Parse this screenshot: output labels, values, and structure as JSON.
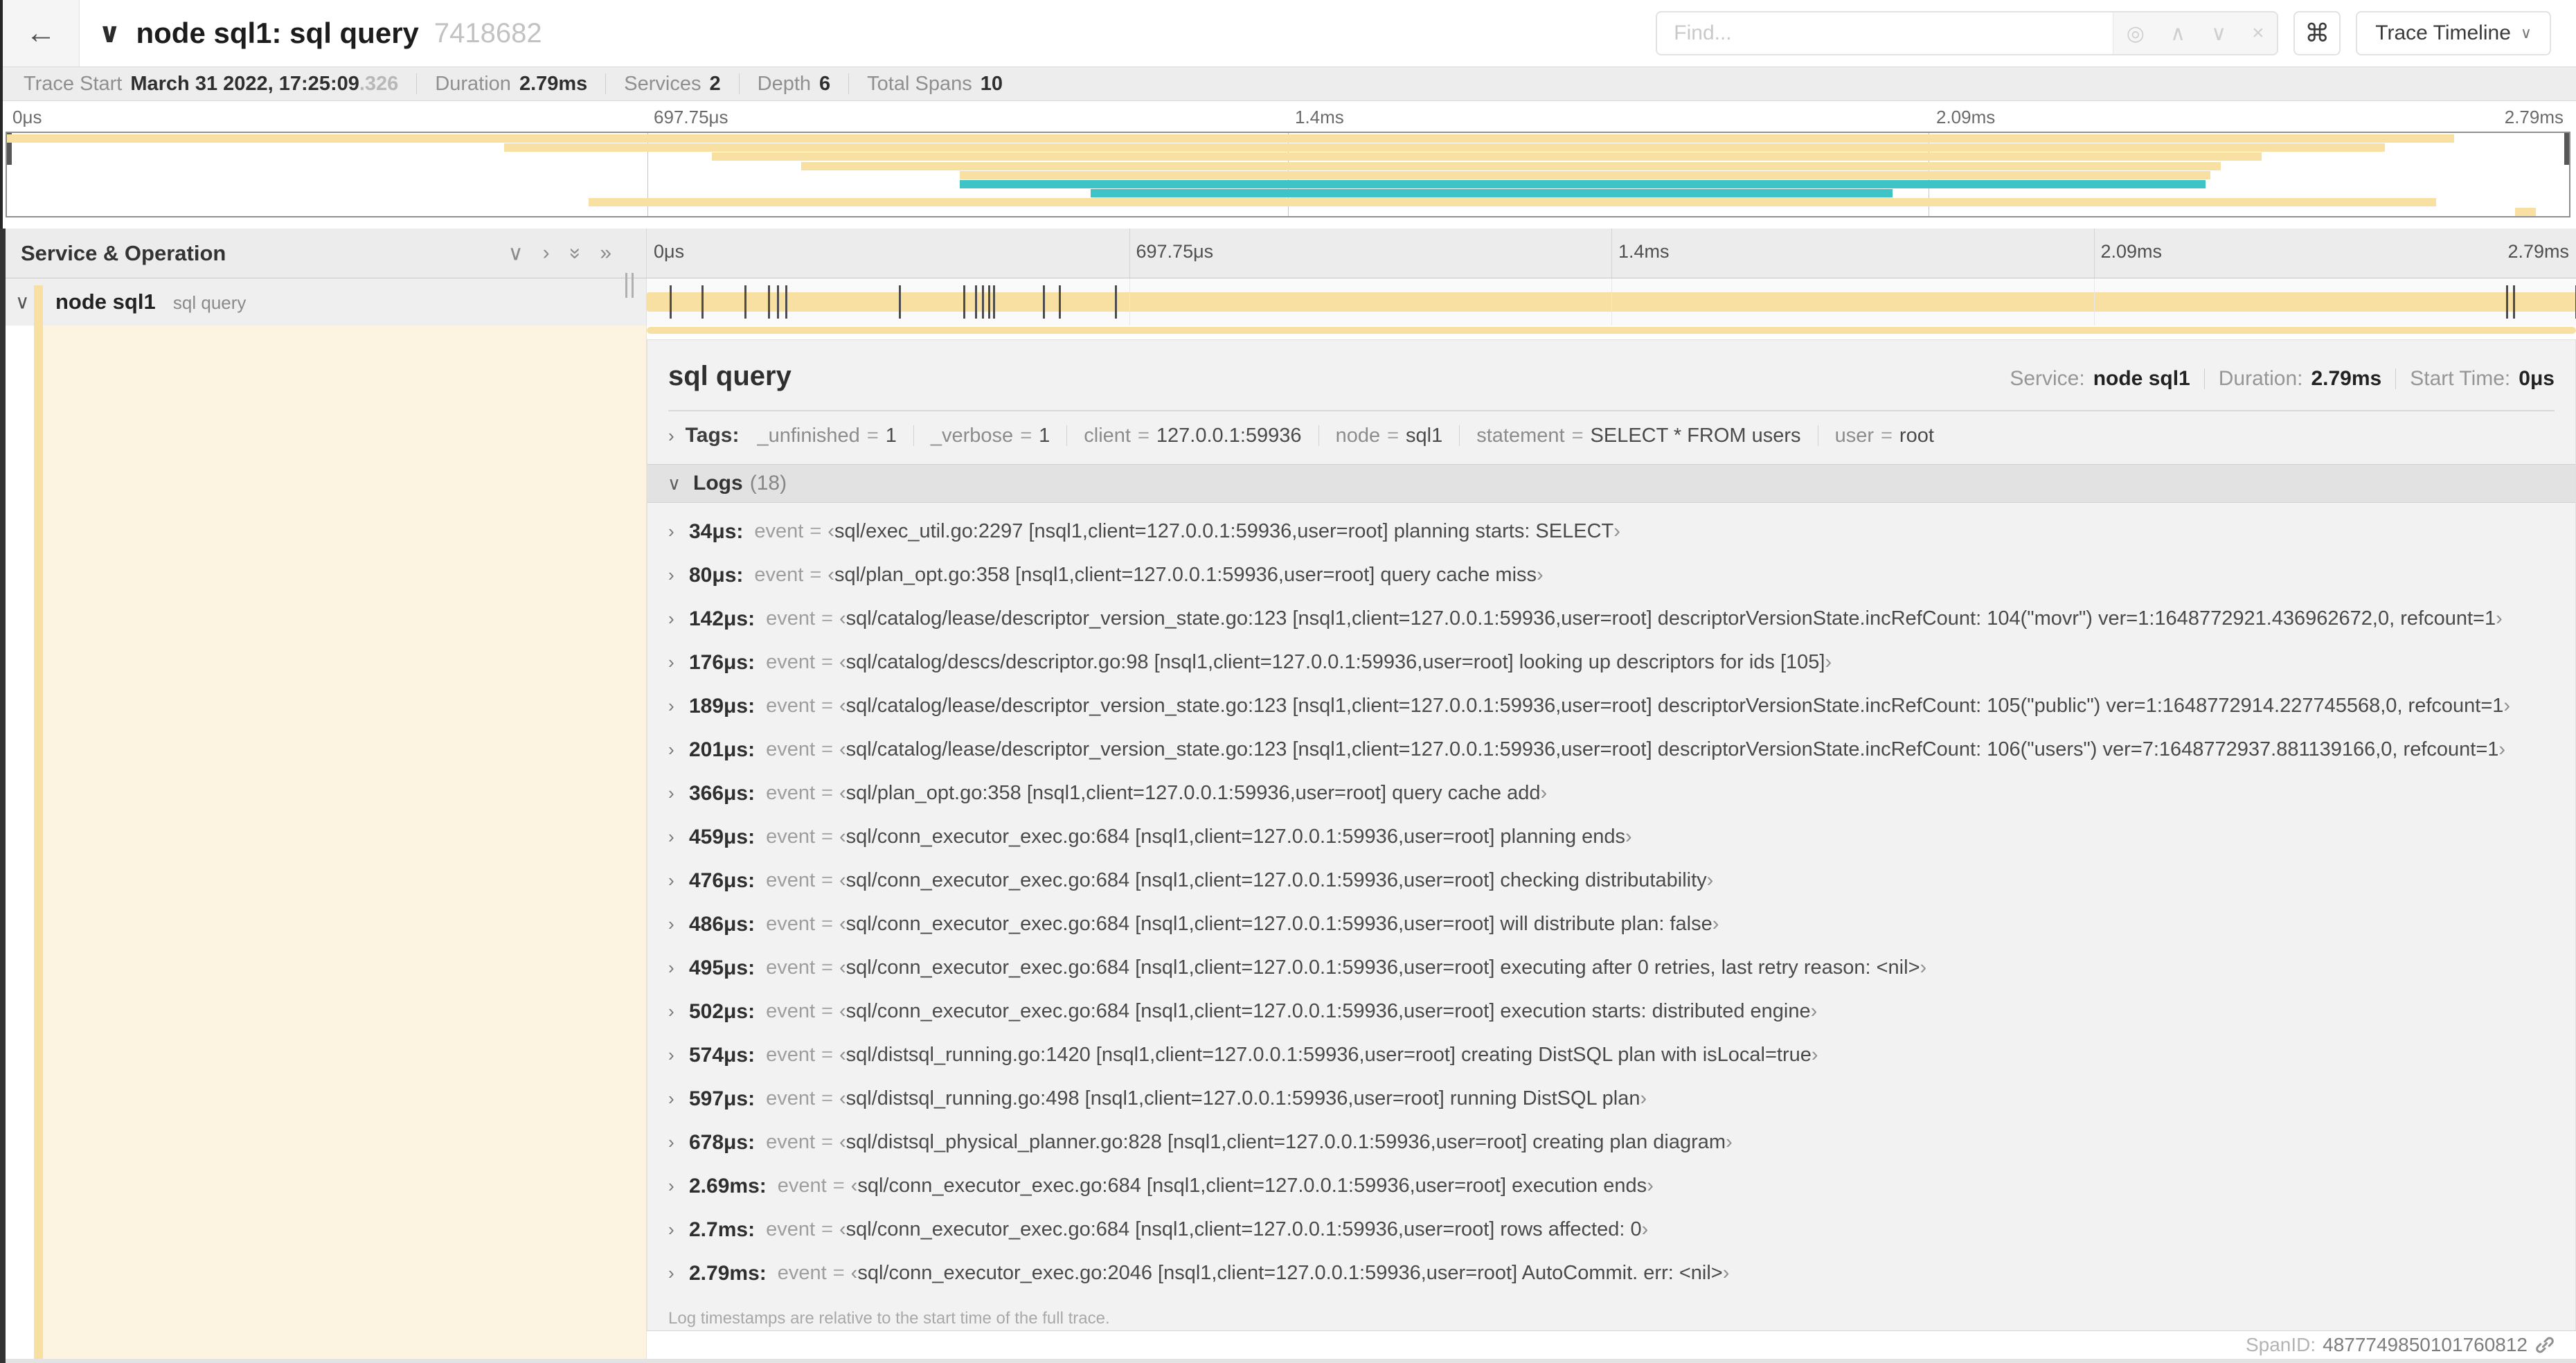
{
  "colors": {
    "span": "#f7e0a2",
    "span_light": "#fcf4e1",
    "teal": "#3ec3c7"
  },
  "header": {
    "back_icon": "←",
    "collapse_icon": "∨",
    "title": "node sql1: sql query",
    "trace_id": "7418682",
    "find_placeholder": "Find...",
    "find_icons": [
      {
        "name": "target-icon",
        "glyph": "◎"
      },
      {
        "name": "chevron-up-icon",
        "glyph": "∧"
      },
      {
        "name": "chevron-down-icon",
        "glyph": "∨"
      },
      {
        "name": "close-icon",
        "glyph": "×"
      }
    ],
    "command_icon": "⌘",
    "view_dropdown_label": "Trace Timeline",
    "view_dropdown_caret": "∨"
  },
  "stats": {
    "items": [
      {
        "label": "Trace Start",
        "value": "March 31 2022, 17:25:09",
        "suffix": ".326"
      },
      {
        "label": "Duration",
        "value": "2.79ms"
      },
      {
        "label": "Services",
        "value": "2"
      },
      {
        "label": "Depth",
        "value": "6"
      },
      {
        "label": "Total Spans",
        "value": "10"
      }
    ]
  },
  "minimap": {
    "ticks": [
      "0μs",
      "697.75μs",
      "1.4ms",
      "2.09ms",
      "2.79ms"
    ],
    "rows": [
      {
        "slot": 0,
        "start": 0,
        "end": 95.5,
        "color": "tan"
      },
      {
        "slot": 1,
        "start": 19.4,
        "end": 92.8,
        "color": "tan"
      },
      {
        "slot": 2,
        "start": 27.5,
        "end": 88.0,
        "color": "tan"
      },
      {
        "slot": 3,
        "start": 31.0,
        "end": 86.4,
        "color": "tan"
      },
      {
        "slot": 4,
        "start": 37.2,
        "end": 86.0,
        "color": "tan"
      },
      {
        "slot": 5,
        "start": 37.2,
        "end": 85.8,
        "color": "teal"
      },
      {
        "slot": 6,
        "start": 42.3,
        "end": 73.6,
        "color": "teal"
      },
      {
        "slot": 7,
        "start": 22.7,
        "end": 94.8,
        "color": "tan"
      },
      {
        "slot": 8,
        "start": 97.9,
        "end": 98.7,
        "color": "tan"
      }
    ]
  },
  "timeline": {
    "section_title": "Service & Operation",
    "icons": [
      {
        "name": "chevron-down-icon",
        "glyph": "∨",
        "rotate": false
      },
      {
        "name": "chevron-right-icon",
        "glyph": "›",
        "rotate": false
      },
      {
        "name": "double-chevron-down-icon",
        "glyph": "»",
        "rotate": true
      },
      {
        "name": "double-chevron-right-icon",
        "glyph": "»",
        "rotate": false
      }
    ],
    "ticks": [
      "0μs",
      "697.75μs",
      "1.4ms",
      "2.09ms",
      "2.79ms"
    ],
    "row": {
      "collapse_icon": "∨",
      "service": "node sql1",
      "operation": "sql query"
    },
    "duration_us": 2790,
    "event_times_us": [
      34,
      80,
      142,
      176,
      189,
      201,
      366,
      459,
      476,
      486,
      495,
      502,
      574,
      597,
      678,
      2690,
      2700,
      2790
    ]
  },
  "detail": {
    "title": "sql query",
    "meta": [
      {
        "label": "Service:",
        "value": "node sql1"
      },
      {
        "label": "Duration:",
        "value": "2.79ms"
      },
      {
        "label": "Start Time:",
        "value": "0μs"
      }
    ],
    "tags_chevron": "›",
    "tags_label": "Tags:",
    "tags": [
      {
        "key": "_unfinished",
        "value": "1"
      },
      {
        "key": "_verbose",
        "value": "1"
      },
      {
        "key": "client",
        "value": "127.0.0.1:59936"
      },
      {
        "key": "node",
        "value": "sql1"
      },
      {
        "key": "statement",
        "value": "SELECT * FROM users"
      },
      {
        "key": "user",
        "value": "root"
      }
    ],
    "logs_chevron": "∨",
    "logs_label": "Logs",
    "logs_count": "(18)",
    "log_row_chevron": "›",
    "log_key": "event",
    "log_eq": "=",
    "quote_open": "‹",
    "quote_close": "›",
    "logs": [
      {
        "time": "34μs:",
        "value": "sql/exec_util.go:2297 [nsql1,client=127.0.0.1:59936,user=root] planning starts: SELECT"
      },
      {
        "time": "80μs:",
        "value": "sql/plan_opt.go:358 [nsql1,client=127.0.0.1:59936,user=root] query cache miss"
      },
      {
        "time": "142μs:",
        "value": "sql/catalog/lease/descriptor_version_state.go:123 [nsql1,client=127.0.0.1:59936,user=root] descriptorVersionState.incRefCount: 104(\"movr\") ver=1:1648772921.436962672,0, refcount=1"
      },
      {
        "time": "176μs:",
        "value": "sql/catalog/descs/descriptor.go:98 [nsql1,client=127.0.0.1:59936,user=root] looking up descriptors for ids [105]"
      },
      {
        "time": "189μs:",
        "value": "sql/catalog/lease/descriptor_version_state.go:123 [nsql1,client=127.0.0.1:59936,user=root] descriptorVersionState.incRefCount: 105(\"public\") ver=1:1648772914.227745568,0, refcount=1"
      },
      {
        "time": "201μs:",
        "value": "sql/catalog/lease/descriptor_version_state.go:123 [nsql1,client=127.0.0.1:59936,user=root] descriptorVersionState.incRefCount: 106(\"users\") ver=7:1648772937.881139166,0, refcount=1"
      },
      {
        "time": "366μs:",
        "value": "sql/plan_opt.go:358 [nsql1,client=127.0.0.1:59936,user=root] query cache add"
      },
      {
        "time": "459μs:",
        "value": "sql/conn_executor_exec.go:684 [nsql1,client=127.0.0.1:59936,user=root] planning ends"
      },
      {
        "time": "476μs:",
        "value": "sql/conn_executor_exec.go:684 [nsql1,client=127.0.0.1:59936,user=root] checking distributability"
      },
      {
        "time": "486μs:",
        "value": "sql/conn_executor_exec.go:684 [nsql1,client=127.0.0.1:59936,user=root] will distribute plan: false"
      },
      {
        "time": "495μs:",
        "value": "sql/conn_executor_exec.go:684 [nsql1,client=127.0.0.1:59936,user=root] executing after 0 retries, last retry reason: <nil>"
      },
      {
        "time": "502μs:",
        "value": "sql/conn_executor_exec.go:684 [nsql1,client=127.0.0.1:59936,user=root] execution starts: distributed engine"
      },
      {
        "time": "574μs:",
        "value": "sql/distsql_running.go:1420 [nsql1,client=127.0.0.1:59936,user=root] creating DistSQL plan with isLocal=true"
      },
      {
        "time": "597μs:",
        "value": "sql/distsql_running.go:498 [nsql1,client=127.0.0.1:59936,user=root] running DistSQL plan"
      },
      {
        "time": "678μs:",
        "value": "sql/distsql_physical_planner.go:828 [nsql1,client=127.0.0.1:59936,user=root] creating plan diagram"
      },
      {
        "time": "2.69ms:",
        "value": "sql/conn_executor_exec.go:684 [nsql1,client=127.0.0.1:59936,user=root] execution ends"
      },
      {
        "time": "2.7ms:",
        "value": "sql/conn_executor_exec.go:684 [nsql1,client=127.0.0.1:59936,user=root] rows affected: 0"
      },
      {
        "time": "2.79ms:",
        "value": "sql/conn_executor_exec.go:2046 [nsql1,client=127.0.0.1:59936,user=root] AutoCommit. err: <nil>"
      }
    ],
    "footer": "Log timestamps are relative to the start time of the full trace.",
    "spanid_label": "SpanID:",
    "spanid_value": "4877749850101760812"
  }
}
